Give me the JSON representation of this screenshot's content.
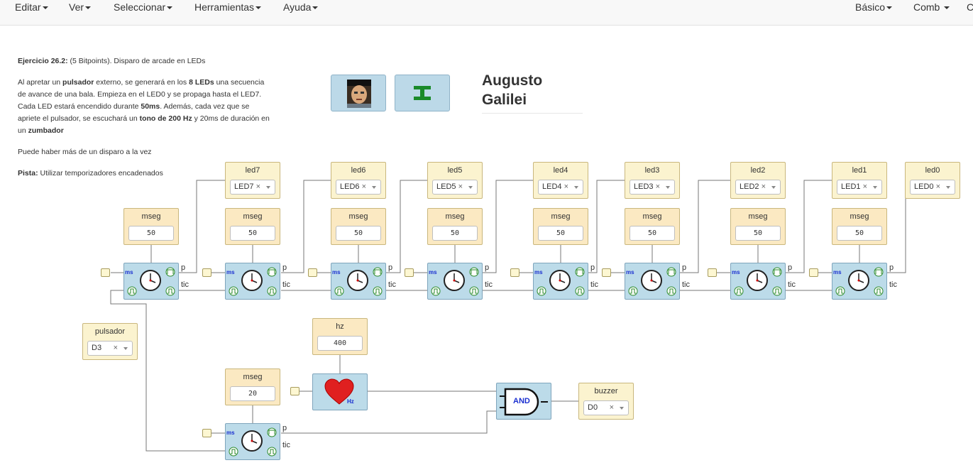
{
  "menu": {
    "left": [
      "Editar",
      "Ver",
      "Seleccionar",
      "Herramientas",
      "Ayuda"
    ],
    "right": [
      "Básico",
      "Comb",
      "C"
    ]
  },
  "exercise": {
    "title_bold": "Ejercicio 26.2:",
    "title_rest": " (5 Bitpoints). Disparo de arcade en LEDs",
    "p1_a": "Al apretar un ",
    "p1_b": "pulsador",
    "p1_c": " externo, se generará en los ",
    "p1_d": "8 LEDs",
    "p1_e": " una secuencia de avance de una bala. Empieza en el LED0 y se propaga hasta el LED7. Cada LED estará encendido durante ",
    "p1_f": "50ms",
    "p1_g": ". Además, cada vez que se apriete el pulsador, se escuchará un ",
    "p1_h": "tono de 200 Hz",
    "p1_i": " y 20ms de duración en un ",
    "p1_j": "zumbador",
    "p2": "Puede haber más de un disparo a la vez",
    "p3_bold": "Pista:",
    "p3_rest": " Utilizar temporizadores encadenados"
  },
  "author": {
    "line1": "Augusto",
    "line2": "Galilei"
  },
  "leds": [
    {
      "title": "led7",
      "value": "LED7"
    },
    {
      "title": "led6",
      "value": "LED6"
    },
    {
      "title": "led5",
      "value": "LED5"
    },
    {
      "title": "led4",
      "value": "LED4"
    },
    {
      "title": "led3",
      "value": "LED3"
    },
    {
      "title": "led2",
      "value": "LED2"
    },
    {
      "title": "led1",
      "value": "LED1"
    },
    {
      "title": "led0",
      "value": "LED0"
    }
  ],
  "mseg_blocks": [
    {
      "title": "mseg",
      "value": "50"
    },
    {
      "title": "mseg",
      "value": "50"
    },
    {
      "title": "mseg",
      "value": "50"
    },
    {
      "title": "mseg",
      "value": "50"
    },
    {
      "title": "mseg",
      "value": "50"
    },
    {
      "title": "mseg",
      "value": "50"
    },
    {
      "title": "mseg",
      "value": "50"
    },
    {
      "title": "mseg",
      "value": "50"
    }
  ],
  "ports": {
    "p": "p",
    "tic": "tic",
    "ms": "ms",
    "hz": "Hz"
  },
  "pulsador": {
    "title": "pulsador",
    "value": "D3"
  },
  "hz_block": {
    "title": "hz",
    "value": "400"
  },
  "mseg_buzzer": {
    "title": "mseg",
    "value": "20"
  },
  "and_label": "AND",
  "buzzer": {
    "title": "buzzer",
    "value": "D0"
  },
  "select_clear": "×",
  "colors": {
    "wire": "#777777",
    "block_blue": "#bcdbe9",
    "const_yellow": "#fbf3cf",
    "heart": "#e02020",
    "ms_text": "#1a2fd0"
  }
}
